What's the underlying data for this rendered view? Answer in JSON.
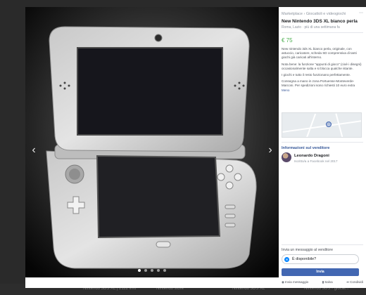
{
  "background": {
    "bottom_items": [
      "Nintendo 3DS XL | 2112 info",
      "Nintendo store",
      "Nintendo 3DS XL",
      "Nintendo 3DS • giocat..."
    ]
  },
  "gallery": {
    "prev_icon": "chevron-left-icon",
    "next_icon": "chevron-right-icon",
    "dot_count": 5,
    "active_dot": 0
  },
  "listing": {
    "breadcrumb": "Marketplace › Giocattoli e videogiochi",
    "title": "New Nintendo 3DS XL bianco perla",
    "location": "Roma, Lazio · più di una settimana fa",
    "price": "€ 75",
    "description": [
      "New nintendo 3ds XL bianco perla, originale, con astuccio, caricatore, scheda SD comprensiva di tanti giochi già caricati all'interno.",
      "Nota bene: la funzione \"appunti di gioco\" (cioè i disegni) occasionalmente salta e si blocca qualche istante.",
      "I giochi e tutto il resto funzionano perfettamente."
    ],
    "delivery": "Consegna a mano in zona Portuense-Monteverde-Marconi. Per spedizioni sono richiesti 10 euro extra",
    "delivery_link": "Meno",
    "accent_color": "#4caf50"
  },
  "seller": {
    "heading": "Informazioni sul venditore",
    "name": "Leonardo Dragoni",
    "since": "Iscritto/a a Facebook nel 2017"
  },
  "message": {
    "heading": "Invia un messaggio al venditore",
    "input_value": "È disponibile?",
    "send_label": "Invia",
    "actions": [
      "Invia messaggio",
      "Salva",
      "Condividi"
    ]
  }
}
